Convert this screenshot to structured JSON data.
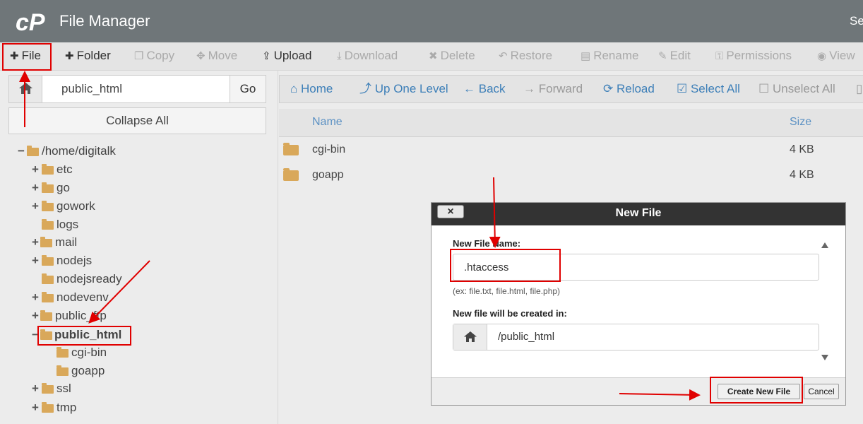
{
  "header": {
    "title": "File Manager",
    "right_text": "Se"
  },
  "toolbar": {
    "file": "File",
    "folder": "Folder",
    "copy": "Copy",
    "move": "Move",
    "upload": "Upload",
    "download": "Download",
    "delete": "Delete",
    "restore": "Restore",
    "rename": "Rename",
    "edit": "Edit",
    "permissions": "Permissions",
    "view": "View"
  },
  "left": {
    "path_value": "public_html",
    "go_label": "Go",
    "collapse_label": "Collapse All",
    "tree": [
      {
        "label": "/home/digitalk",
        "toggle": "−"
      },
      {
        "label": "etc",
        "toggle": "+"
      },
      {
        "label": "go",
        "toggle": "+"
      },
      {
        "label": "gowork",
        "toggle": "+"
      },
      {
        "label": "logs",
        "toggle": ""
      },
      {
        "label": "mail",
        "toggle": "+"
      },
      {
        "label": "nodejs",
        "toggle": "+"
      },
      {
        "label": "nodejsready",
        "toggle": ""
      },
      {
        "label": "nodevenv",
        "toggle": "+"
      },
      {
        "label": "public_ftp",
        "toggle": "+"
      },
      {
        "label": "public_html",
        "toggle": "−"
      },
      {
        "label": "cgi-bin",
        "toggle": ""
      },
      {
        "label": "goapp",
        "toggle": ""
      },
      {
        "label": "ssl",
        "toggle": "+"
      },
      {
        "label": "tmp",
        "toggle": "+"
      }
    ]
  },
  "nav": {
    "home": "Home",
    "up": "Up One Level",
    "back": "Back",
    "forward": "Forward",
    "reload": "Reload",
    "select_all": "Select All",
    "unselect_all": "Unselect All"
  },
  "list": {
    "col_name": "Name",
    "col_size": "Size",
    "rows": [
      {
        "name": "cgi-bin",
        "size": "4 KB"
      },
      {
        "name": "goapp",
        "size": "4 KB"
      }
    ]
  },
  "dialog": {
    "title": "New File",
    "close": "×",
    "name_label": "New File Name:",
    "name_value": ".htaccess",
    "hint": "(ex: file.txt, file.html, file.php)",
    "location_label": "New file will be created in:",
    "location_value": "/public_html",
    "create_label": "Create New File",
    "cancel_label": "Cancel"
  },
  "colors": {
    "header": "#6f7679",
    "link": "#3d7fb8",
    "folder": "#d9a85a",
    "annotation": "#e00000"
  }
}
